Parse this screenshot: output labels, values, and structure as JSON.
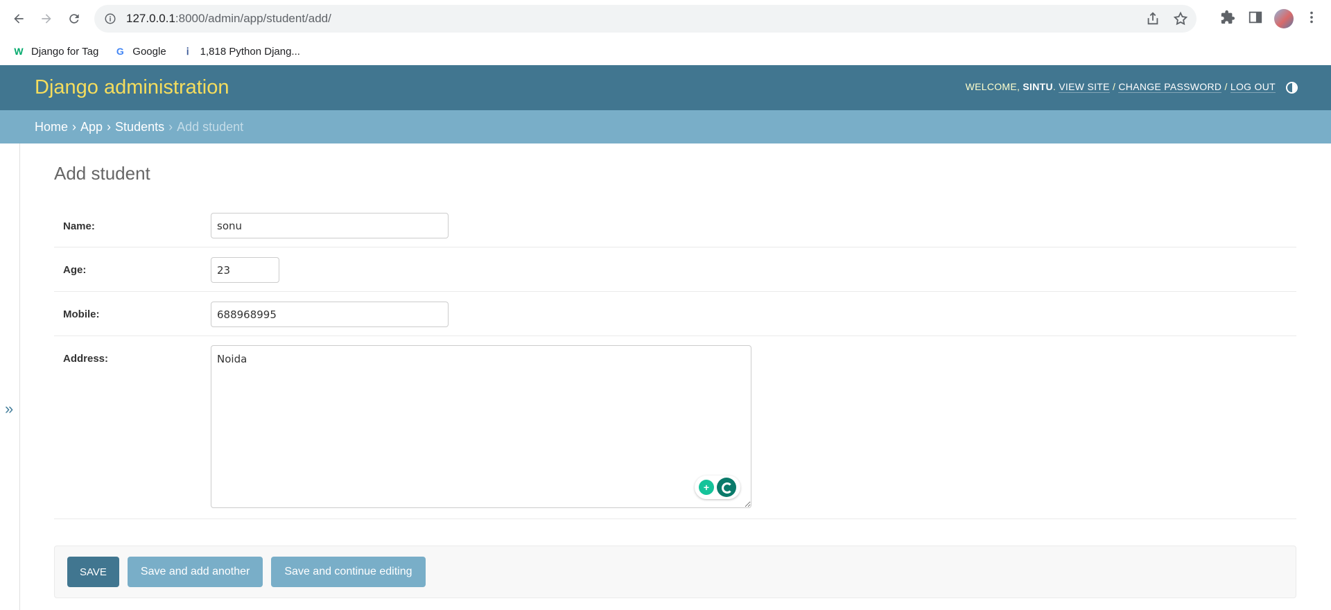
{
  "browser": {
    "url_host": "127.0.0.1",
    "url_rest": ":8000/admin/app/student/add/"
  },
  "bookmarks": [
    {
      "label": "Django for Tag",
      "icon": "w3-icon"
    },
    {
      "label": "Google",
      "icon": "google-icon"
    },
    {
      "label": "1,818 Python Djang...",
      "icon": "pinterest-icon"
    }
  ],
  "header": {
    "branding": "Django administration",
    "welcome": "Welcome, ",
    "username": "sintu",
    "view_site": "View site",
    "change_password": "Change password",
    "log_out": "Log out"
  },
  "breadcrumbs": {
    "home": "Home",
    "app": "App",
    "students": "Students",
    "current": "Add student"
  },
  "sidebar": {
    "toggle": "»"
  },
  "page": {
    "title": "Add student"
  },
  "form": {
    "name_label": "Name:",
    "name_value": "sonu",
    "age_label": "Age:",
    "age_value": "23",
    "mobile_label": "Mobile:",
    "mobile_value": "688968995",
    "address_label": "Address:",
    "address_value": "Noida"
  },
  "buttons": {
    "save": "Save",
    "save_add_another": "Save and add another",
    "save_continue": "Save and continue editing"
  },
  "colors": {
    "header_bg": "#417690",
    "breadcrumb_bg": "#79aec8",
    "branding": "#f5dd5d"
  }
}
